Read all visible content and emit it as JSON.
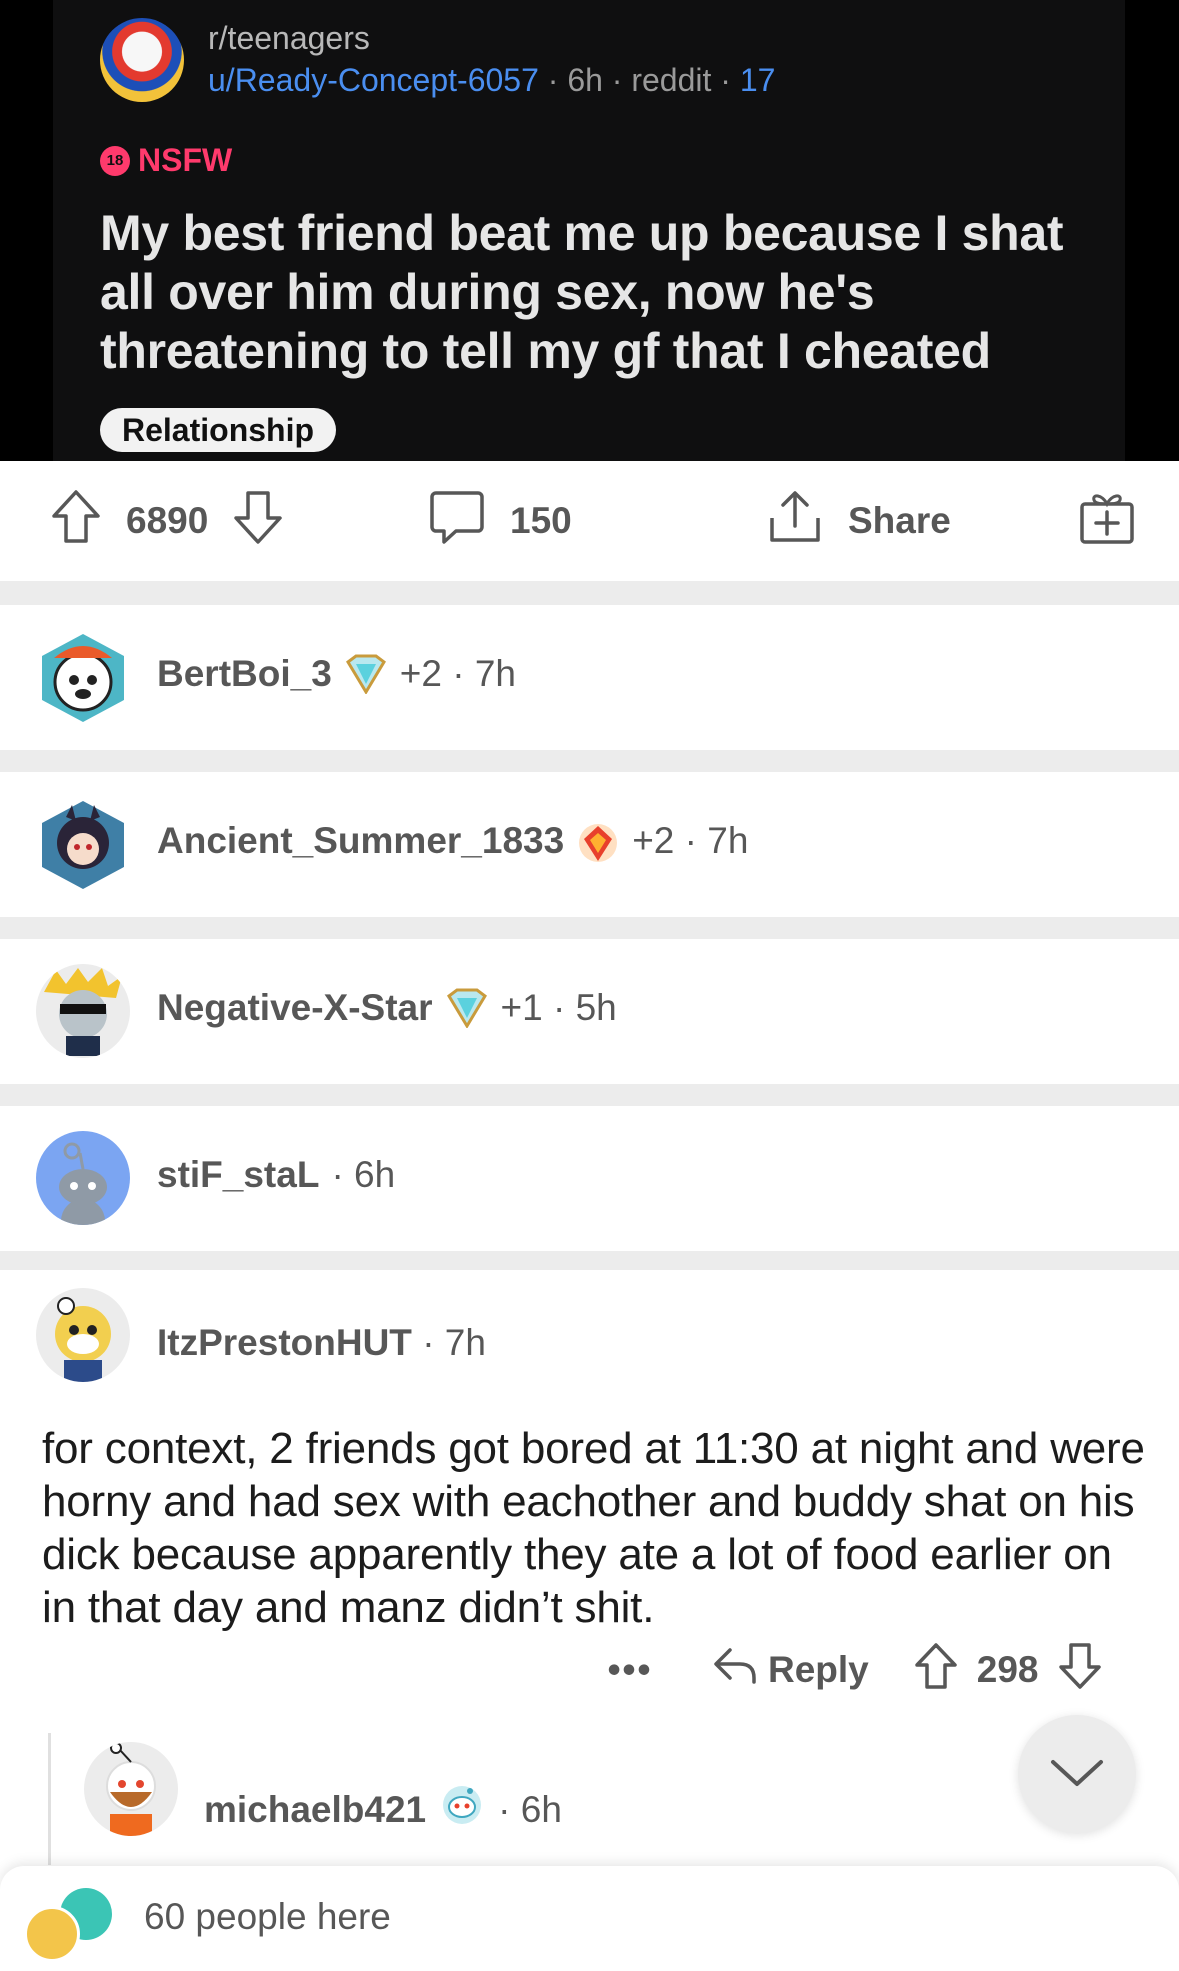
{
  "post": {
    "subreddit": "r/teenagers",
    "author": "u/Ready-Concept-6057",
    "age": "6h",
    "source": "reddit",
    "awards_count": "17",
    "nsfw_badge": "18",
    "nsfw_label": "NSFW",
    "title": "My best friend beat me up because I shat all over him during sex, now he's threatening to tell my gf that I cheated",
    "flair": "Relationship"
  },
  "action_bar": {
    "votes": "6890",
    "comments": "150",
    "share_label": "Share"
  },
  "collapsed_comments": [
    {
      "user": "BertBoi_3",
      "extra": "+2 · 7h",
      "avatar_color": "#4db6c6",
      "award": "diamond"
    },
    {
      "user": "Ancient_Summer_1833",
      "extra": "+2 · 7h",
      "avatar_color": "#3f7fa6",
      "award": "fire-gem"
    },
    {
      "user": "Negative-X-Star",
      "extra": "+1 · 5h",
      "avatar_color": "#e8e8e8",
      "award": "diamond"
    },
    {
      "user": "stiF_staL",
      "extra": "· 6h",
      "avatar_color": "#7ba5f2",
      "award": ""
    }
  ],
  "expanded_comment": {
    "user": "ItzPrestonHUT",
    "age": "· 7h",
    "body": "for context, 2 friends got bored at 11:30 at night and were horny and had sex with eachother and buddy shat on his dick because apparently they ate a lot of food earlier on in that day and manz didn’t shit.",
    "more": "•••",
    "reply_label": "Reply",
    "score": "298"
  },
  "child_comment": {
    "user": "michaelb421",
    "age": "· 6h"
  },
  "bottom_bar": {
    "presence": "60 people here"
  },
  "colors": {
    "post_bg": "#0f0f10",
    "link_blue": "#4a8ef0",
    "nsfw_pink": "#ff3a6c",
    "meta_gray": "#575757",
    "band_gray": "#ececec"
  }
}
